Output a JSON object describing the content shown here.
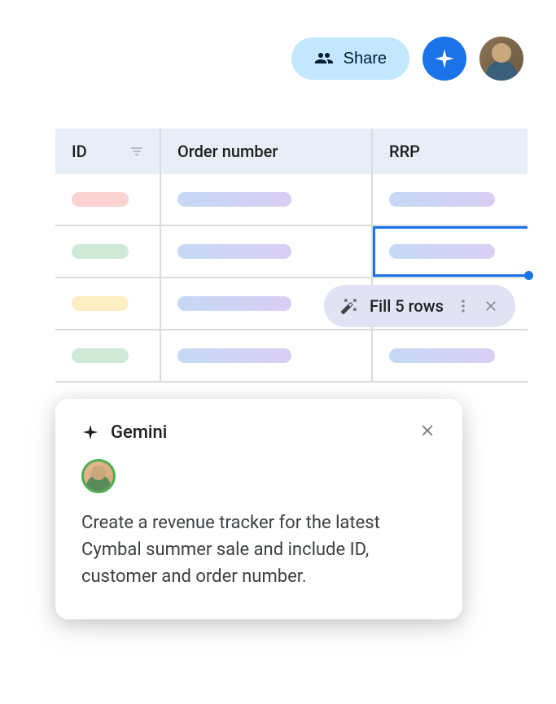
{
  "topbar": {
    "share_label": "Share"
  },
  "table": {
    "columns": {
      "id": "ID",
      "order": "Order number",
      "rrp": "RRP"
    }
  },
  "fill_pill": {
    "label": "Fill 5 rows"
  },
  "gemini": {
    "title": "Gemini",
    "prompt": "Create a revenue tracker for the latest Cymbal summer sale and include ID, customer and order number."
  }
}
